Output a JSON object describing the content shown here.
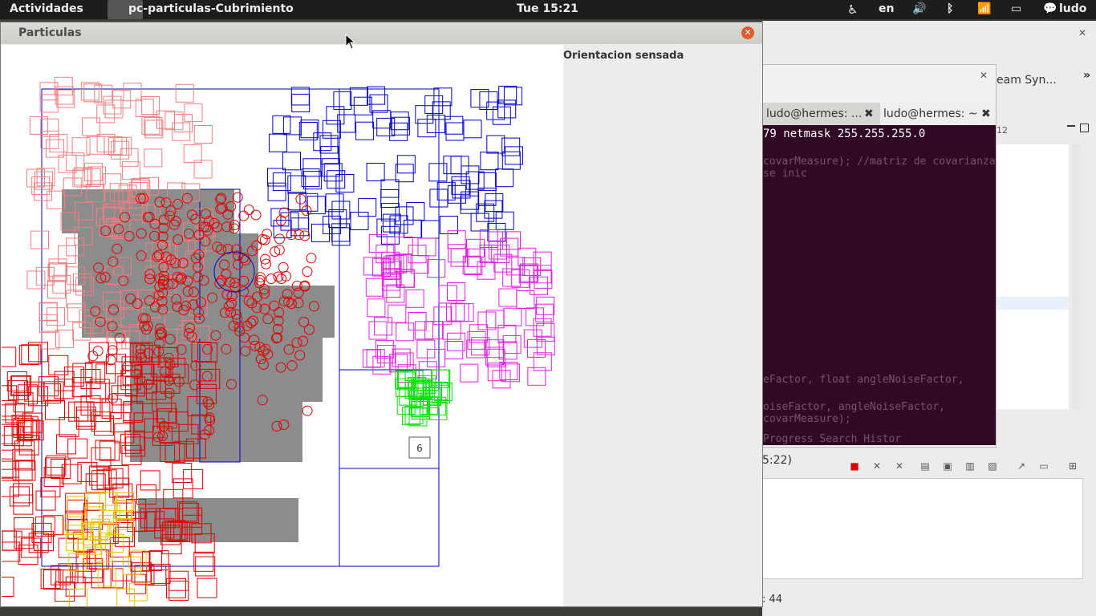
{
  "topbar": {
    "activities": "Actividades",
    "app_title": "pc-particulas-Cubrimiento",
    "clock": "Tue 15:21",
    "lang": "en",
    "user": "ludo"
  },
  "window": {
    "title": "Particulas",
    "side_label": "Orientacion sensada",
    "cell_label": "6"
  },
  "terminal": {
    "tab1": "ludo@hermes: ...",
    "tab2": "ludo@hermes: ~",
    "line": "79 netmask 255.255.255.0",
    "ghost_lines": [
      "covarMeasure);   //matriz de covarianza se inic",
      "eFactor, float angleNoiseFactor,",
      "oiseFactor, angleNoiseFactor, covarMeasure);",
      "Progress  Search  Histor"
    ]
  },
  "eclipse": {
    "team_sync": "eam Syn...",
    "position": "5:22)",
    "status": ": 44",
    "overflow": "»",
    "tab_count": "12"
  },
  "colors": {
    "red": "#e00000",
    "pink": "#f08080",
    "blue": "#0000c8",
    "magenta": "#e020e0",
    "green": "#00e000",
    "yellow": "#e8c000"
  }
}
